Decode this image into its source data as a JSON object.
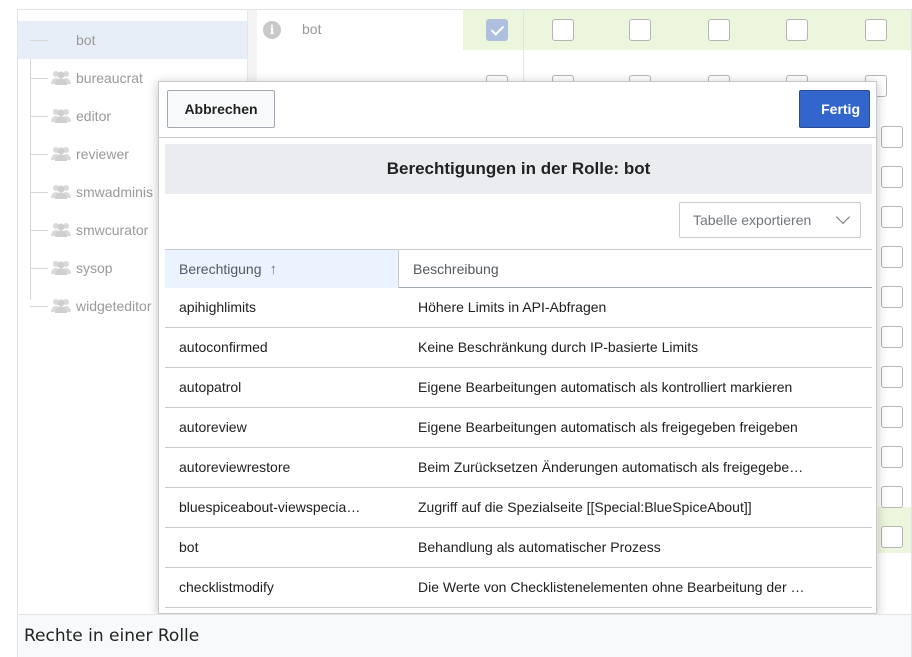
{
  "tree": {
    "groups": [
      {
        "label": "bot",
        "selected": true
      },
      {
        "label": "bureaucrat",
        "selected": false
      },
      {
        "label": "editor",
        "selected": false
      },
      {
        "label": "reviewer",
        "selected": false
      },
      {
        "label": "smwadminis",
        "selected": false
      },
      {
        "label": "smwcurator",
        "selected": false
      },
      {
        "label": "sysop",
        "selected": false
      },
      {
        "label": "widgeteditor",
        "selected": false
      }
    ]
  },
  "grid": {
    "row_label": "bot",
    "info_icon_glyph": "i",
    "accent_green": "#ecf6dc"
  },
  "dialog": {
    "cancel_label": "Abbrechen",
    "done_label": "Fertig",
    "title": "Berechtigungen in der Rolle: bot",
    "export_label": "Tabelle exportieren",
    "columns": {
      "permission": "Berechtigung",
      "sort_arrow": "↑",
      "description": "Beschreibung"
    },
    "rows": [
      {
        "permission": "apihighlimits",
        "description": "Höhere Limits in API-Abfragen"
      },
      {
        "permission": "autoconfirmed",
        "description": "Keine Beschränkung durch IP-basierte Limits"
      },
      {
        "permission": "autopatrol",
        "description": "Eigene Bearbeitungen automatisch als kontrolliert markieren"
      },
      {
        "permission": "autoreview",
        "description": "Eigene Bearbeitungen automatisch als freigegeben freigeben"
      },
      {
        "permission": "autoreviewrestore",
        "description": "Beim Zurücksetzen Änderungen automatisch als freigegebe…"
      },
      {
        "permission": "bluespiceabout-viewspecia…",
        "description": "Zugriff auf die Spezialseite [[Special:BlueSpiceAbout]]"
      },
      {
        "permission": "bot",
        "description": "Behandlung als automatischer Prozess"
      },
      {
        "permission": "checklistmodify",
        "description": "Die Werte von Checklistenelementen ohne Bearbeitung der …"
      }
    ]
  },
  "caption": "Rechte in einer Rolle",
  "colors": {
    "primary_button": "#3366cc",
    "selected_tree_row": "#e8eef8",
    "header_bg": "#eaecf0"
  }
}
